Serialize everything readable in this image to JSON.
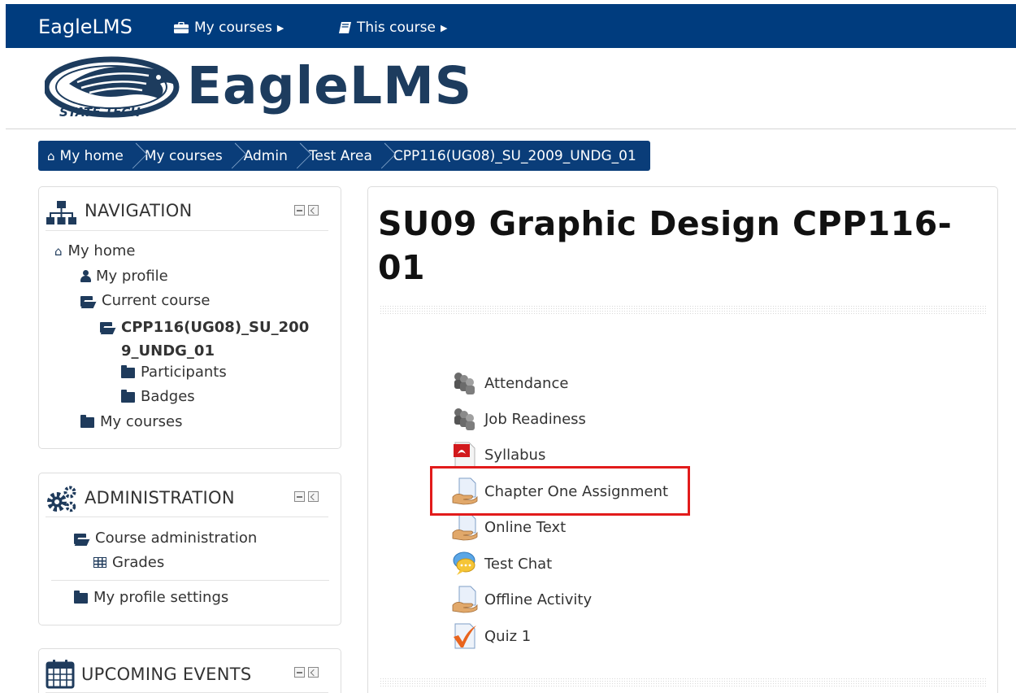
{
  "topbar": {
    "brand": "EagleLMS",
    "menu_my_courses": "My courses",
    "menu_this_course": "This course"
  },
  "header": {
    "logo_text": "EagleLMS",
    "logo_tagline": "STATE TECH"
  },
  "breadcrumb": [
    "My home",
    "My courses",
    "Admin",
    "Test Area",
    "CPP116(UG08)_SU_2009_UNDG_01"
  ],
  "navigation": {
    "title": "NAVIGATION",
    "items": {
      "my_home": "My home",
      "my_profile": "My profile",
      "current_course": "Current course",
      "course_code": "CPP116(UG08)_SU_2009_UNDG_01",
      "participants": "Participants",
      "badges": "Badges",
      "my_courses": "My courses"
    }
  },
  "administration": {
    "title": "ADMINISTRATION",
    "items": {
      "course_administration": "Course administration",
      "grades": "Grades",
      "my_profile_settings": "My profile settings"
    }
  },
  "upcoming_events": {
    "title": "UPCOMING EVENTS"
  },
  "main": {
    "course_title": "SU09 Graphic Design CPP116-01",
    "activities": [
      {
        "label": "Attendance",
        "icon": "attendance-icon"
      },
      {
        "label": "Job Readiness",
        "icon": "attendance-icon"
      },
      {
        "label": "Syllabus",
        "icon": "pdf-icon"
      },
      {
        "label": "Chapter One Assignment",
        "icon": "assignment-icon"
      },
      {
        "label": "Online Text",
        "icon": "assignment-icon"
      },
      {
        "label": "Test Chat",
        "icon": "chat-icon"
      },
      {
        "label": "Offline Activity",
        "icon": "assignment-icon"
      },
      {
        "label": "Quiz 1",
        "icon": "quiz-icon"
      }
    ]
  },
  "colors": {
    "topbar": "#003c7e",
    "breadcrumb": "#0a3d79",
    "highlight": "#e21b1b",
    "icon": "#1f3b5c"
  }
}
